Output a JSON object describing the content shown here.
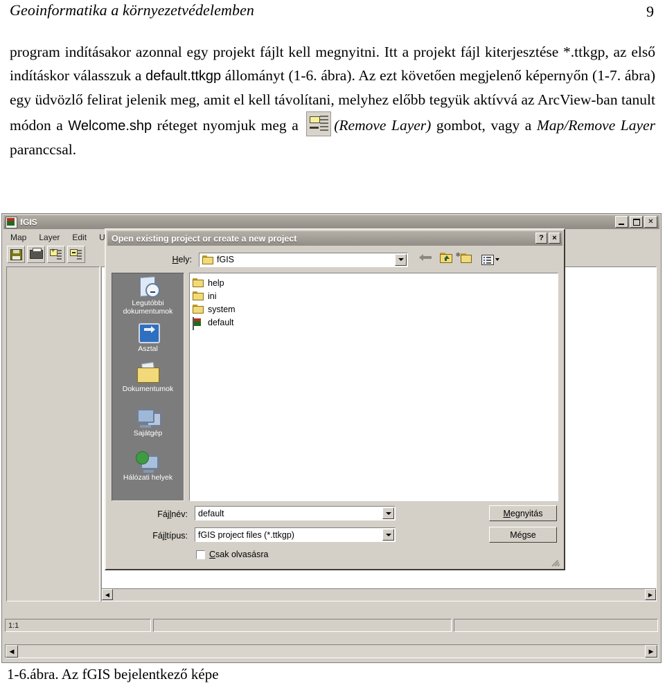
{
  "page": {
    "running_title": "Geoinformatika a környezetvédelemben",
    "page_number": "9"
  },
  "body": {
    "seg1": "program indításakor azonnal egy projekt fájlt kell megnyitni. Itt a projekt fájl kiterjesztése *.ttkgp, az első indításkor válasszuk a ",
    "emphasis1": "default.ttkgp",
    "seg2": " állományt (1-6. ábra). Az ezt követően megjelenő képernyőn (1-7. ábra) egy üdvözlő felirat jelenik meg, amit el kell távolítani, melyhez előbb tegyük aktívvá az ArcView-ban tanult módon a ",
    "emphasis2": "Welcome.shp",
    "seg3": " réteget nyomjuk meg a ",
    "icon_caption": "(Remove Layer)",
    "seg4": " gombot, vagy a ",
    "emphasis3": "Map/Remove Layer",
    "seg5": " paranccsal."
  },
  "figure": {
    "caption": "1-6.ábra. Az fGIS bejelentkező képe"
  },
  "fgis_window": {
    "title": "fGIS",
    "menu": [
      "Map",
      "Layer",
      "Edit",
      "Uti"
    ],
    "toolbar_buttons": [
      "save",
      "print",
      "add-layer",
      "remove-layer"
    ],
    "window_buttons": [
      "minimize",
      "maximize",
      "close"
    ],
    "status": {
      "scale": "1:1",
      "panel2": "",
      "panel3": ""
    }
  },
  "dialog": {
    "title": "Open existing project or create a new project",
    "title_buttons": {
      "help": "?",
      "close": "×"
    },
    "lookin_label": "Hely:",
    "lookin_value": "fGIS",
    "toolbar_icons": [
      "back-arrow",
      "up-one-level",
      "new-folder",
      "views"
    ],
    "places": [
      {
        "label": "Legutóbbi dokumentumok",
        "icon": "recent-documents-icon"
      },
      {
        "label": "Asztal",
        "icon": "desktop-icon"
      },
      {
        "label": "Dokumentumok",
        "icon": "documents-icon"
      },
      {
        "label": "Sajátgép",
        "icon": "my-computer-icon"
      },
      {
        "label": "Hálózati helyek",
        "icon": "network-places-icon"
      }
    ],
    "files": [
      {
        "name": "help",
        "type": "folder"
      },
      {
        "name": "ini",
        "type": "folder"
      },
      {
        "name": "system",
        "type": "folder"
      },
      {
        "name": "default",
        "type": "project"
      }
    ],
    "filename_label": "Fájlnév:",
    "filename_value": "default",
    "filetype_label": "Fájltípus:",
    "filetype_value": "fGIS project files (*.ttkgp)",
    "readonly_label": "Csak olvasásra",
    "open_button": "Megnyitás",
    "cancel_button": "Mégse"
  },
  "colors": {
    "window_face": "#d4d0c8",
    "titlebar": "#a5a199",
    "places_bar": "#7c7c7c",
    "folder_yellow": "#f2d979"
  }
}
